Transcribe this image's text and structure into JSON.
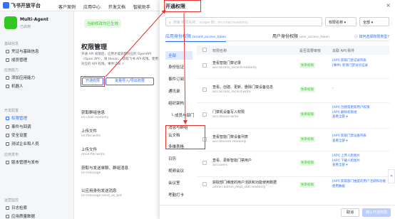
{
  "topbar": {
    "logo": "飞书开放平台",
    "nav": [
      "客户案例",
      "应用中心",
      "开发文档",
      "智能助手"
    ]
  },
  "sidebar": {
    "app_name": "Multi-Agent",
    "app_status": "已启用",
    "groups": [
      {
        "label": "基础信息",
        "items": [
          "凭证与基础信息",
          "成员管理"
        ]
      },
      {
        "label": "应用能力",
        "items": [
          "添加应用能力",
          "机器人"
        ]
      },
      {
        "label": "开发配置",
        "items": [
          "权限管理",
          "事件与回调",
          "安全设置",
          "测试企业和人员"
        ]
      },
      {
        "label": "应用发布",
        "items": [
          "版本管理与发布"
        ]
      },
      {
        "label": "运营监控",
        "items": [
          "日志检索",
          "应用质量数据"
        ]
      }
    ]
  },
  "content": {
    "env_badge": "当前修改均已生效",
    "title": "权限管理",
    "desc": "开通 API 权限后，应用才能调用对应的 OpenAPI（Open API），请 Hesan... 获取飞书 API 权限。使用对应的 API 权限。事件订阅 ↗",
    "open_btn": "开通权限",
    "batch_btn": "批量导入/导出权限",
    "perms": [
      {
        "name": "获取群组信息",
        "code": "im:chat:readonly"
      },
      {
        "name": "上传文件",
        "code": "im:file:write"
      },
      {
        "name": "上传文件",
        "code": "drive:file:write"
      },
      {
        "name": "获取与发送单聊、群组消息",
        "code": "im:message"
      },
      {
        "name": "以应用身份发送消息",
        "code": "im:message:send_as_bot"
      }
    ]
  },
  "modal": {
    "title": "开通权限",
    "close": "×",
    "search_placeholder": "搜索  权限名称、scope  例：im:chat:readonly",
    "select1": "权限名称",
    "select2": "全部",
    "tab_app": "应用身份权限",
    "tab_app_sub": "tenant_access_token",
    "tab_user": "用户身份权限",
    "tab_user_sub": "user_access_token",
    "help": "如何选择权限类型?",
    "categories": [
      "全部",
      "身份验证",
      "事件订阅",
      "通讯录",
      "组织架构",
      "└ 成员与部门",
      "消息与群组",
      "云文档",
      "多维表格",
      "日历",
      "视频会议",
      "会议室",
      "考勤打卡",
      "审批"
    ],
    "columns": [
      "权限名称",
      "是否需要审核",
      "关联 API/事件"
    ],
    "rows": [
      {
        "name": "查看智能门禁记录",
        "code": "acs:access_record:readonly",
        "badge": "免审权限",
        "api": [
          "[API] 获取门禁记录列表",
          "[事件] 新增门禁访问记录"
        ]
      },
      {
        "name": "查看、创建、更新、删除门禁设备信息",
        "code": "acs:access_record:write",
        "badge": "免审权限",
        "api": [
          "-"
        ]
      },
      {
        "name": "门禁机设备写入权限",
        "code": "acs:device:write",
        "badge": "免审权限",
        "api": [
          "[API] 创建或更新用户权限",
          "[API] 删除权限组",
          "查看全部 ▾"
        ]
      },
      {
        "name": "查看智能门禁设备列表",
        "code": "acs:devices:readonly",
        "badge": "免审权限",
        "api": [
          "[API] 获取门禁设备列表",
          "查看全部 ▾"
        ]
      },
      {
        "name": "查看、更新智能门禁用户",
        "code": "acs:users",
        "badge": "免审权限",
        "api": [
          "[API] 上传人脸图片",
          "[API] 下载人脸图片",
          "查看全部 ▾"
        ]
      },
      {
        "name": "获取部门维度的用户活跃和功能使用数据",
        "code": "admin:admin_dept_stat:readonly",
        "badge": "免审权限",
        "api": [
          "[API] 获取部门维度的用户活跃和功能使用数据"
        ]
      }
    ],
    "cancel": "取消",
    "confirm": "确认开通权限"
  },
  "annotation_color": "#e8342a"
}
